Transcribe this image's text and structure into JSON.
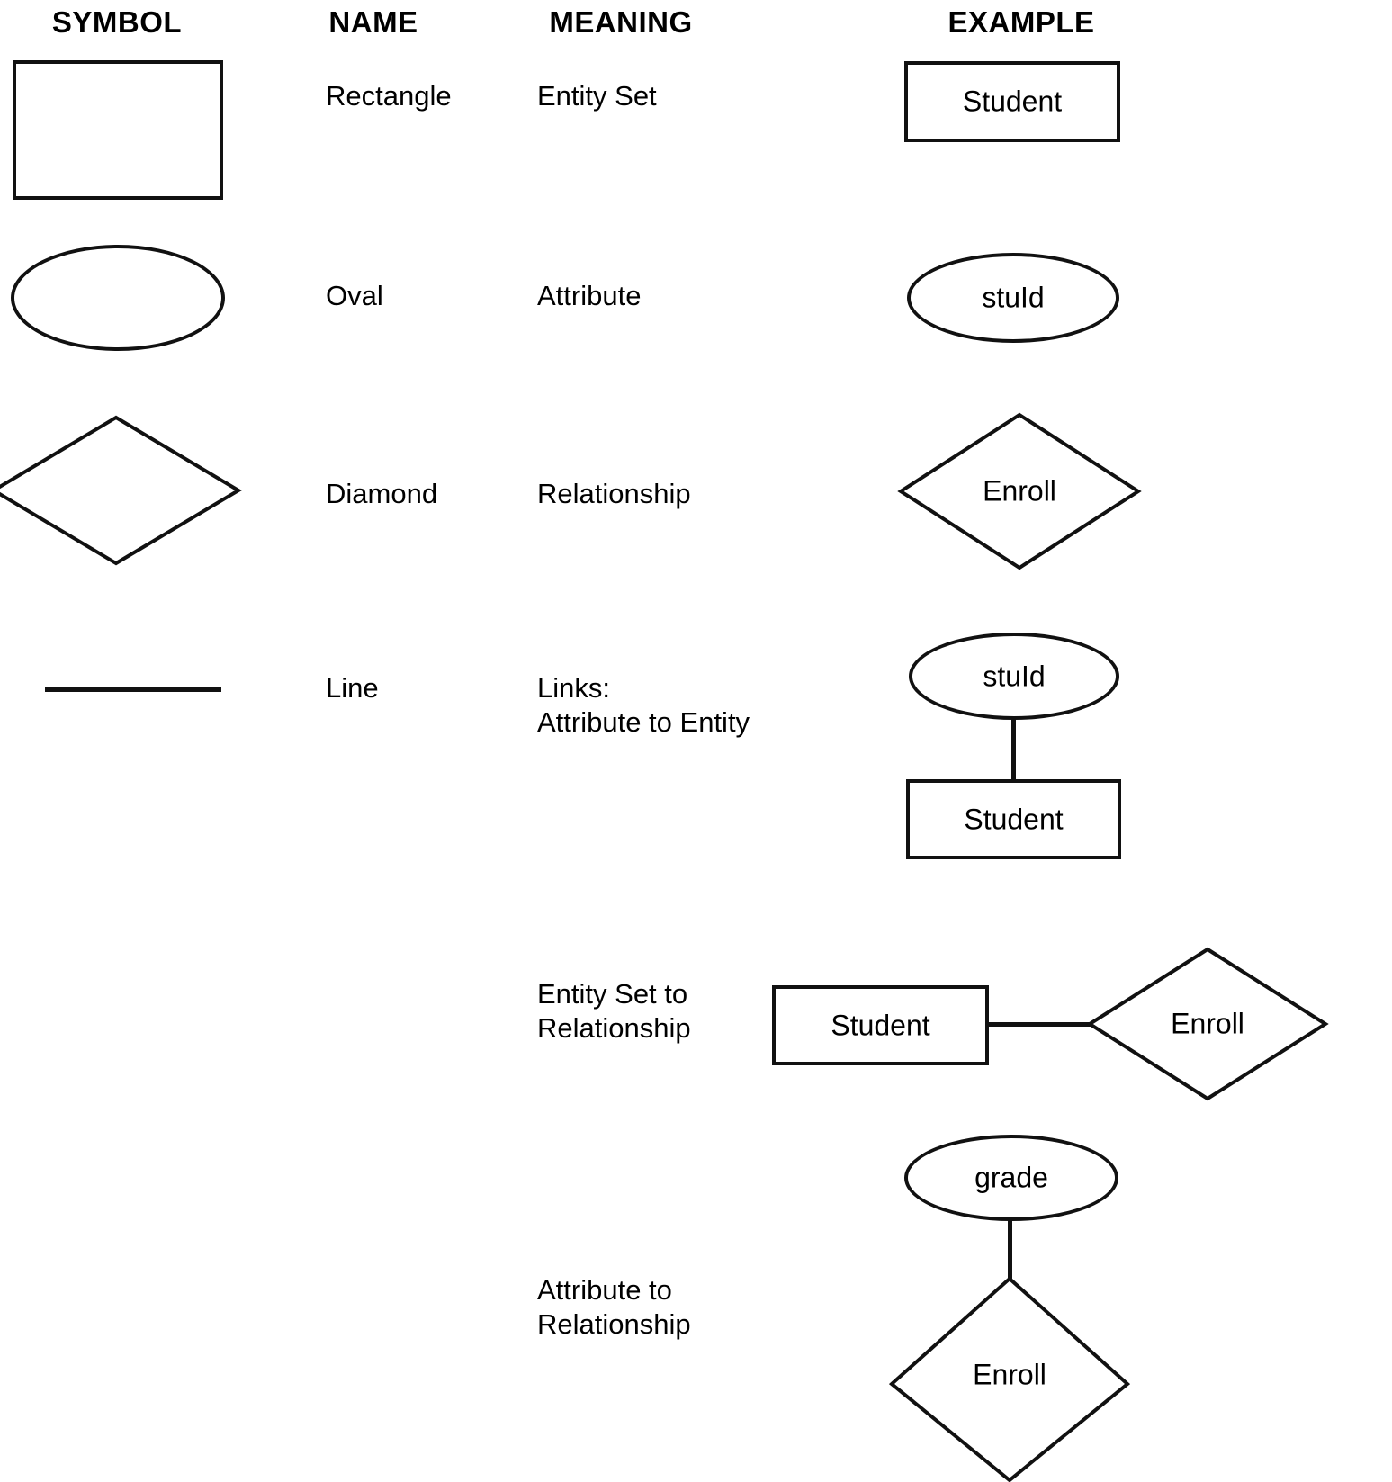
{
  "headers": {
    "symbol": "SYMBOL",
    "name": "NAME",
    "meaning": "MEANING",
    "example": "EXAMPLE"
  },
  "rows": [
    {
      "name": "Rectangle",
      "meaning": "Entity Set",
      "symbol_shape": "rectangle",
      "example_labels": {
        "entity": "Student"
      }
    },
    {
      "name": "Oval",
      "meaning": "Attribute",
      "symbol_shape": "oval",
      "example_labels": {
        "attribute": "stuId"
      }
    },
    {
      "name": "Diamond",
      "meaning": "Relationship",
      "symbol_shape": "diamond",
      "example_labels": {
        "relationship": "Enroll"
      }
    },
    {
      "name": "Line",
      "meaning": "Links:\nAttribute to Entity",
      "symbol_shape": "line",
      "example_labels": {
        "attribute": "stuId",
        "entity": "Student"
      }
    },
    {
      "name": "",
      "meaning": "Entity Set to\nRelationship",
      "symbol_shape": "none",
      "example_labels": {
        "entity": "Student",
        "relationship": "Enroll"
      }
    },
    {
      "name": "",
      "meaning": "Attribute to\nRelationship",
      "symbol_shape": "none",
      "example_labels": {
        "attribute": "grade",
        "relationship": "Enroll"
      }
    }
  ],
  "colors": {
    "stroke": "#111111",
    "background": "#ffffff",
    "text": "#000000"
  }
}
